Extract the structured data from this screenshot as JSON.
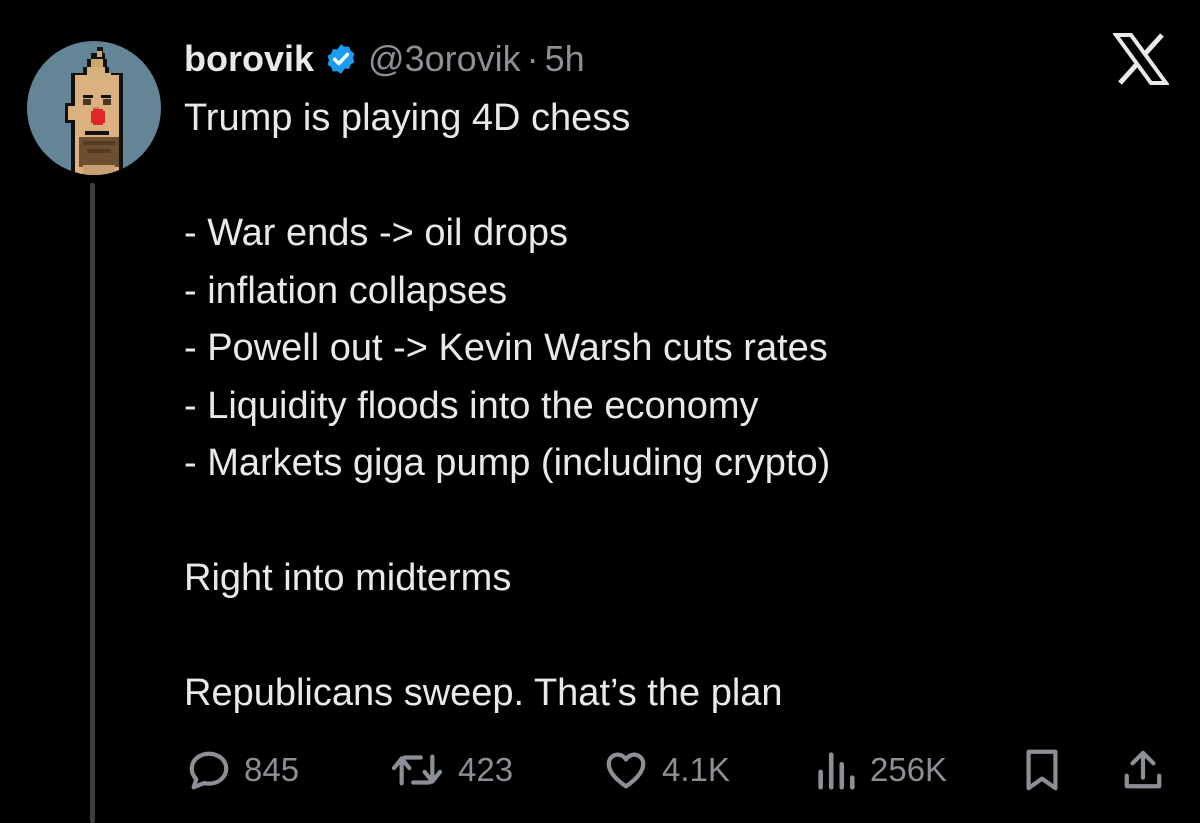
{
  "tweet": {
    "display_name": "borovik",
    "handle": "@3orovik",
    "separator": "·",
    "time": "5h",
    "body": "Trump is playing 4D chess\n\n- War ends -> oil drops\n- inflation collapses\n- Powell out -> Kevin Warsh cuts rates\n- Liquidity floods into the economy\n- Markets giga pump (including crypto)\n\nRight into midterms\n\nRepublicans sweep. That’s the plan"
  },
  "actions": {
    "replies": "845",
    "reposts": "423",
    "likes": "4.1K",
    "views": "256K"
  },
  "icons": {
    "verified": "verified-badge-icon",
    "brand": "x-logo-icon",
    "reply": "reply-icon",
    "repost": "repost-icon",
    "like": "heart-icon",
    "views": "views-icon",
    "bookmark": "bookmark-icon",
    "share": "share-icon"
  },
  "colors": {
    "background": "#000000",
    "text": "#e7e9ea",
    "muted": "#8b9096",
    "verified": "#1d9bf0",
    "avatar_bg": "#648596"
  }
}
